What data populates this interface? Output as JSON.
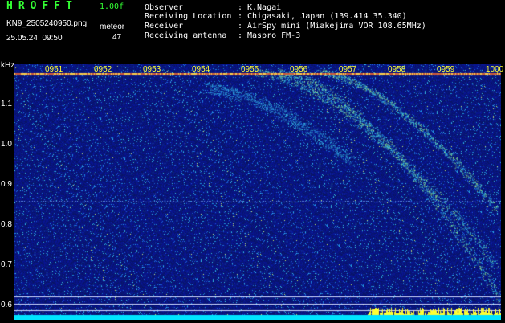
{
  "header": {
    "app_title": "HROFFT",
    "version": "1.00f",
    "file_name": "KN9_2505240950.png",
    "datetime": "25.05.24  09:50",
    "meteor_label": "meteor",
    "meteor_count": "47"
  },
  "info": [
    {
      "label": "Observer",
      "value": "K.Nagai"
    },
    {
      "label": "Receiving Location",
      "value": "Chigasaki, Japan (139.414 35.340)"
    },
    {
      "label": "Receiver",
      "value": "AirSpy mini (Miakejima VOR 108.65MHz)"
    },
    {
      "label": "Receiving antenna",
      "value": "Maspro FM-3"
    }
  ],
  "axis": {
    "y_unit": "kHz",
    "y_ticks": [
      "1.1",
      "1.0",
      "0.9",
      "0.8",
      "0.7",
      "0.6"
    ],
    "x_ticks": [
      "0951",
      "0952",
      "0953",
      "0954",
      "0955",
      "0956",
      "0957",
      "0958",
      "0959",
      "1000"
    ]
  },
  "colors": {
    "background": "#000000",
    "spectrogram_base": "#0a1a6e",
    "grid": "#ffffff",
    "label_yellow": "#ffff33",
    "title_green": "#33ff33",
    "baseline": "#00e5ff"
  }
}
